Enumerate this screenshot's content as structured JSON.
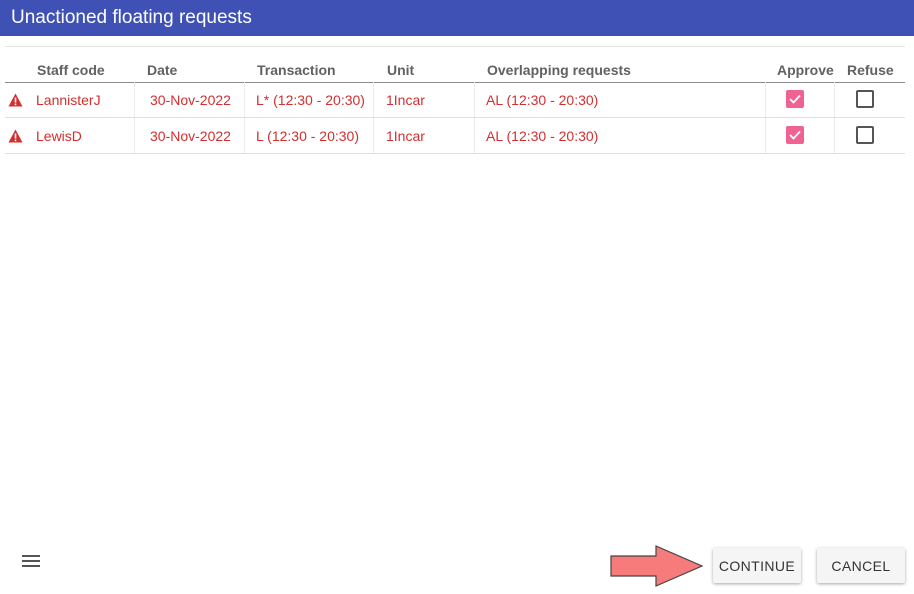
{
  "dialog": {
    "title": "Unactioned floating requests"
  },
  "colors": {
    "titlebar": "#3f51b5",
    "row_text": "#d32f2f",
    "checkbox_checked": "#f06292",
    "arrow": "#f77b7b"
  },
  "table": {
    "headers": {
      "staff_code": "Staff code",
      "date": "Date",
      "transaction": "Transaction",
      "unit": "Unit",
      "overlapping": "Overlapping requests",
      "approve": "Approve",
      "refuse": "Refuse"
    },
    "rows": [
      {
        "staff_code": "LannisterJ",
        "date": "30-Nov-2022",
        "transaction": "L* (12:30 - 20:30)",
        "unit": "1Incar",
        "overlapping": "AL (12:30 - 20:30)",
        "approve": true,
        "refuse": false
      },
      {
        "staff_code": "LewisD",
        "date": "30-Nov-2022",
        "transaction": "L (12:30 - 20:30)",
        "unit": "1Incar",
        "overlapping": "AL (12:30 - 20:30)",
        "approve": true,
        "refuse": false
      }
    ]
  },
  "footer": {
    "menu_icon": "hamburger-menu-icon",
    "continue_label": "CONTINUE",
    "cancel_label": "CANCEL",
    "annotation": "arrow-pointing-right"
  }
}
